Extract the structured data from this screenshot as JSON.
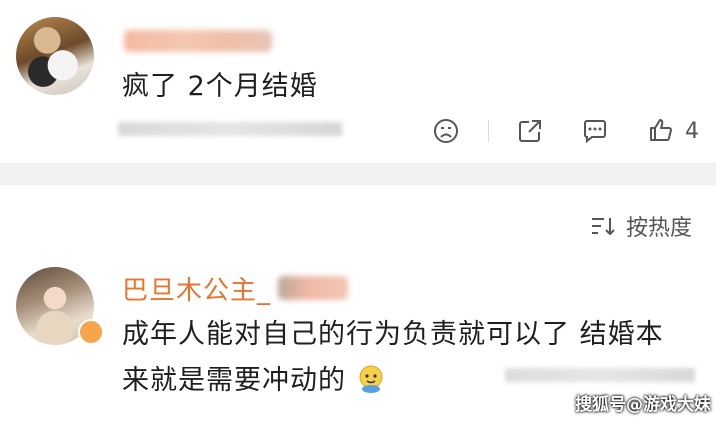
{
  "comments": [
    {
      "text": "疯了 2个月结婚",
      "actions": {
        "like_count": "4"
      }
    },
    {
      "author": "巴旦木公主_",
      "text_line1": "成年人能对自己的行为负责就可以了 结婚本",
      "text_line2": "来就是需要冲动的"
    }
  ],
  "sort": {
    "label": "按热度"
  },
  "watermark": "搜狐号@游戏大妹",
  "icons": [
    "dislike-face-icon",
    "share-icon",
    "comment-icon",
    "like-thumb-icon",
    "sort-icon",
    "emoji-icon"
  ]
}
